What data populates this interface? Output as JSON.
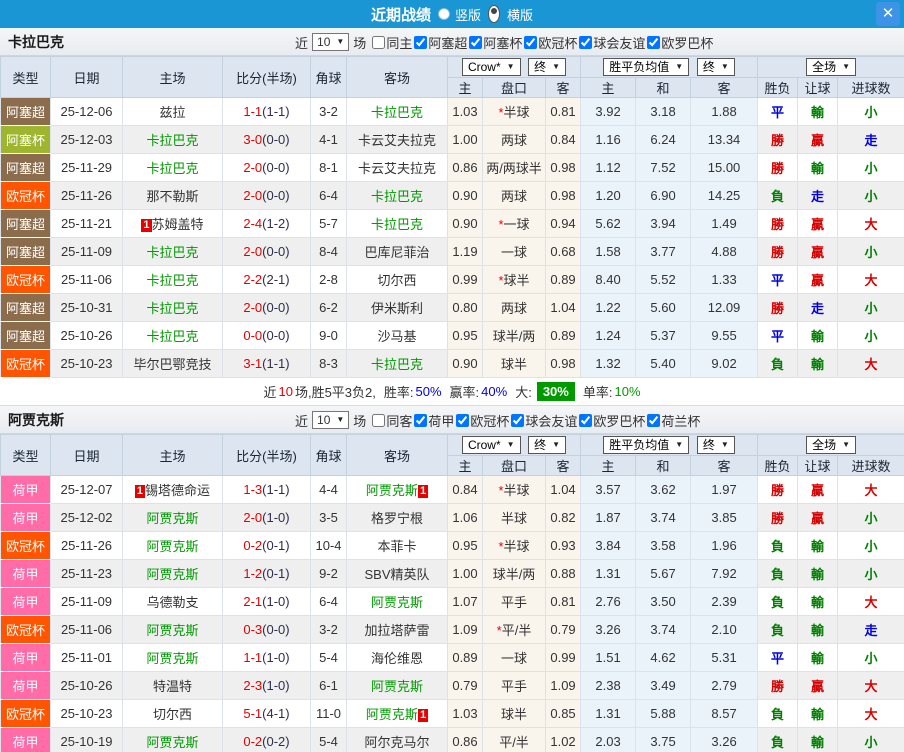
{
  "titlebar": {
    "title": "近期战绩",
    "vertical_label": "竖版",
    "horizontal_label": "横版"
  },
  "icons": {
    "close": "✕",
    "dropdown": "▼"
  },
  "hdr": {
    "type": "类型",
    "date": "日期",
    "home": "主场",
    "score": "比分(半场)",
    "corner": "角球",
    "away": "客场",
    "crow": "Crow*",
    "end": "终",
    "avg": "胜平负均值",
    "full": "全场",
    "sub_home": "主",
    "sub_pk": "盘口",
    "sub_away": "客",
    "sub_home2": "主",
    "sub_draw": "和",
    "sub_away2": "客",
    "sub_wl": "胜负",
    "sub_hcp": "让球",
    "sub_goals": "进球数"
  },
  "colors": {
    "阿塞超": "#8B6D4E",
    "阿塞杯": "#9DB52F",
    "欧冠杯": "#FF5400",
    "荷甲": "#FF6CA8",
    "荷兰杯": "#FF6CA8"
  },
  "sections": [
    {
      "team": "卡拉巴克",
      "filter": {
        "near": "近",
        "count": "10",
        "games": "场",
        "same": "同主",
        "same_checked": false,
        "leagues": [
          "阿塞超",
          "阿塞杯",
          "欧冠杯",
          "球会友谊",
          "欧罗巴杯"
        ]
      },
      "rows": [
        {
          "league": "阿塞超",
          "date": "25-12-06",
          "home_badge": "",
          "home": "兹拉",
          "home_green": false,
          "score": "1-1",
          "half": "(1-1)",
          "corner": "3-2",
          "away": "卡拉巴克",
          "away_badge": "",
          "away_green": true,
          "o_home": "1.03",
          "handicap": "*半球",
          "o_away": "0.81",
          "avg_home": "3.92",
          "avg_draw": "3.18",
          "avg_away": "1.88",
          "res": "平",
          "hres": "輸",
          "gres": "小"
        },
        {
          "league": "阿塞杯",
          "date": "25-12-03",
          "home_badge": "",
          "home": "卡拉巴克",
          "home_green": true,
          "score": "3-0",
          "half": "(0-0)",
          "corner": "4-1",
          "away": "卡云艾夫拉克",
          "away_badge": "",
          "away_green": false,
          "o_home": "1.00",
          "handicap": "两球",
          "o_away": "0.84",
          "avg_home": "1.16",
          "avg_draw": "6.24",
          "avg_away": "13.34",
          "res": "勝",
          "hres": "贏",
          "gres": "走"
        },
        {
          "league": "阿塞超",
          "date": "25-11-29",
          "home_badge": "",
          "home": "卡拉巴克",
          "home_green": true,
          "score": "2-0",
          "half": "(0-0)",
          "corner": "8-1",
          "away": "卡云艾夫拉克",
          "away_badge": "",
          "away_green": false,
          "o_home": "0.86",
          "handicap": "两/两球半",
          "o_away": "0.98",
          "avg_home": "1.12",
          "avg_draw": "7.52",
          "avg_away": "15.00",
          "res": "勝",
          "hres": "輸",
          "gres": "小"
        },
        {
          "league": "欧冠杯",
          "date": "25-11-26",
          "home_badge": "",
          "home": "那不勒斯",
          "home_green": false,
          "score": "2-0",
          "half": "(0-0)",
          "corner": "6-4",
          "away": "卡拉巴克",
          "away_badge": "",
          "away_green": true,
          "o_home": "0.90",
          "handicap": "两球",
          "o_away": "0.98",
          "avg_home": "1.20",
          "avg_draw": "6.90",
          "avg_away": "14.25",
          "res": "負",
          "hres": "走",
          "gres": "小"
        },
        {
          "league": "阿塞超",
          "date": "25-11-21",
          "home_badge": "1",
          "home": "苏姆盖特",
          "home_green": false,
          "score": "2-4",
          "half": "(1-2)",
          "corner": "5-7",
          "away": "卡拉巴克",
          "away_badge": "",
          "away_green": true,
          "o_home": "0.90",
          "handicap": "*一球",
          "o_away": "0.94",
          "avg_home": "5.62",
          "avg_draw": "3.94",
          "avg_away": "1.49",
          "res": "勝",
          "hres": "贏",
          "gres": "大"
        },
        {
          "league": "阿塞超",
          "date": "25-11-09",
          "home_badge": "",
          "home": "卡拉巴克",
          "home_green": true,
          "score": "2-0",
          "half": "(0-0)",
          "corner": "8-4",
          "away": "巴库尼菲治",
          "away_badge": "",
          "away_green": false,
          "o_home": "1.19",
          "handicap": "一球",
          "o_away": "0.68",
          "avg_home": "1.58",
          "avg_draw": "3.77",
          "avg_away": "4.88",
          "res": "勝",
          "hres": "贏",
          "gres": "小"
        },
        {
          "league": "欧冠杯",
          "date": "25-11-06",
          "home_badge": "",
          "home": "卡拉巴克",
          "home_green": true,
          "score": "2-2",
          "half": "(2-1)",
          "corner": "2-8",
          "away": "切尔西",
          "away_badge": "",
          "away_green": false,
          "o_home": "0.99",
          "handicap": "*球半",
          "o_away": "0.89",
          "avg_home": "8.40",
          "avg_draw": "5.52",
          "avg_away": "1.33",
          "res": "平",
          "hres": "贏",
          "gres": "大"
        },
        {
          "league": "阿塞超",
          "date": "25-10-31",
          "home_badge": "",
          "home": "卡拉巴克",
          "home_green": true,
          "score": "2-0",
          "half": "(0-0)",
          "corner": "6-2",
          "away": "伊米斯利",
          "away_badge": "",
          "away_green": false,
          "o_home": "0.80",
          "handicap": "两球",
          "o_away": "1.04",
          "avg_home": "1.22",
          "avg_draw": "5.60",
          "avg_away": "12.09",
          "res": "勝",
          "hres": "走",
          "gres": "小"
        },
        {
          "league": "阿塞超",
          "date": "25-10-26",
          "home_badge": "",
          "home": "卡拉巴克",
          "home_green": true,
          "score": "0-0",
          "half": "(0-0)",
          "corner": "9-0",
          "away": "沙马基",
          "away_badge": "",
          "away_green": false,
          "o_home": "0.95",
          "handicap": "球半/两",
          "o_away": "0.89",
          "avg_home": "1.24",
          "avg_draw": "5.37",
          "avg_away": "9.55",
          "res": "平",
          "hres": "輸",
          "gres": "小"
        },
        {
          "league": "欧冠杯",
          "date": "25-10-23",
          "home_badge": "",
          "home": "毕尔巴鄂竞技",
          "home_green": false,
          "score": "3-1",
          "half": "(1-1)",
          "corner": "8-3",
          "away": "卡拉巴克",
          "away_badge": "",
          "away_green": true,
          "o_home": "0.90",
          "handicap": "球半",
          "o_away": "0.98",
          "avg_home": "1.32",
          "avg_draw": "5.40",
          "avg_away": "9.02",
          "res": "負",
          "hres": "輸",
          "gres": "大"
        }
      ],
      "summary": {
        "near": "近",
        "count": "10",
        "record": "场,胜5平3负2,",
        "win_label": "胜率:",
        "win": "50%",
        "profit_label": "赢率:",
        "profit": "40%",
        "big_label": "大:",
        "big": "30%",
        "single_label": "单率:",
        "single": "10%"
      }
    },
    {
      "team": "阿贾克斯",
      "filter": {
        "near": "近",
        "count": "10",
        "games": "场",
        "same": "同客",
        "same_checked": false,
        "leagues": [
          "荷甲",
          "欧冠杯",
          "球会友谊",
          "欧罗巴杯",
          "荷兰杯"
        ]
      },
      "rows": [
        {
          "league": "荷甲",
          "date": "25-12-07",
          "home_badge": "1",
          "home": "锡塔德命运",
          "home_green": false,
          "score": "1-3",
          "half": "(1-1)",
          "corner": "4-4",
          "away": "阿贾克斯",
          "away_badge": "1",
          "away_green": true,
          "o_home": "0.84",
          "handicap": "*半球",
          "o_away": "1.04",
          "avg_home": "3.57",
          "avg_draw": "3.62",
          "avg_away": "1.97",
          "res": "勝",
          "hres": "贏",
          "gres": "大"
        },
        {
          "league": "荷甲",
          "date": "25-12-02",
          "home_badge": "",
          "home": "阿贾克斯",
          "home_green": true,
          "score": "2-0",
          "half": "(1-0)",
          "corner": "3-5",
          "away": "格罗宁根",
          "away_badge": "",
          "away_green": false,
          "o_home": "1.06",
          "handicap": "半球",
          "o_away": "0.82",
          "avg_home": "1.87",
          "avg_draw": "3.74",
          "avg_away": "3.85",
          "res": "勝",
          "hres": "贏",
          "gres": "小"
        },
        {
          "league": "欧冠杯",
          "date": "25-11-26",
          "home_badge": "",
          "home": "阿贾克斯",
          "home_green": true,
          "score": "0-2",
          "half": "(0-1)",
          "corner": "10-4",
          "away": "本菲卡",
          "away_badge": "",
          "away_green": false,
          "o_home": "0.95",
          "handicap": "*半球",
          "o_away": "0.93",
          "avg_home": "3.84",
          "avg_draw": "3.58",
          "avg_away": "1.96",
          "res": "負",
          "hres": "輸",
          "gres": "小"
        },
        {
          "league": "荷甲",
          "date": "25-11-23",
          "home_badge": "",
          "home": "阿贾克斯",
          "home_green": true,
          "score": "1-2",
          "half": "(0-1)",
          "corner": "9-2",
          "away": "SBV精英队",
          "away_badge": "",
          "away_green": false,
          "o_home": "1.00",
          "handicap": "球半/两",
          "o_away": "0.88",
          "avg_home": "1.31",
          "avg_draw": "5.67",
          "avg_away": "7.92",
          "res": "負",
          "hres": "輸",
          "gres": "小"
        },
        {
          "league": "荷甲",
          "date": "25-11-09",
          "home_badge": "",
          "home": "乌德勒支",
          "home_green": false,
          "score": "2-1",
          "half": "(1-0)",
          "corner": "6-4",
          "away": "阿贾克斯",
          "away_badge": "",
          "away_green": true,
          "o_home": "1.07",
          "handicap": "平手",
          "o_away": "0.81",
          "avg_home": "2.76",
          "avg_draw": "3.50",
          "avg_away": "2.39",
          "res": "負",
          "hres": "輸",
          "gres": "大"
        },
        {
          "league": "欧冠杯",
          "date": "25-11-06",
          "home_badge": "",
          "home": "阿贾克斯",
          "home_green": true,
          "score": "0-3",
          "half": "(0-0)",
          "corner": "3-2",
          "away": "加拉塔萨雷",
          "away_badge": "",
          "away_green": false,
          "o_home": "1.09",
          "handicap": "*平/半",
          "o_away": "0.79",
          "avg_home": "3.26",
          "avg_draw": "3.74",
          "avg_away": "2.10",
          "res": "負",
          "hres": "輸",
          "gres": "走"
        },
        {
          "league": "荷甲",
          "date": "25-11-01",
          "home_badge": "",
          "home": "阿贾克斯",
          "home_green": true,
          "score": "1-1",
          "half": "(1-0)",
          "corner": "5-4",
          "away": "海伦维恩",
          "away_badge": "",
          "away_green": false,
          "o_home": "0.89",
          "handicap": "一球",
          "o_away": "0.99",
          "avg_home": "1.51",
          "avg_draw": "4.62",
          "avg_away": "5.31",
          "res": "平",
          "hres": "輸",
          "gres": "小"
        },
        {
          "league": "荷甲",
          "date": "25-10-26",
          "home_badge": "",
          "home": "特温特",
          "home_green": false,
          "score": "2-3",
          "half": "(1-0)",
          "corner": "6-1",
          "away": "阿贾克斯",
          "away_badge": "",
          "away_green": true,
          "o_home": "0.79",
          "handicap": "平手",
          "o_away": "1.09",
          "avg_home": "2.38",
          "avg_draw": "3.49",
          "avg_away": "2.79",
          "res": "勝",
          "hres": "贏",
          "gres": "大"
        },
        {
          "league": "欧冠杯",
          "date": "25-10-23",
          "home_badge": "",
          "home": "切尔西",
          "home_green": false,
          "score": "5-1",
          "half": "(4-1)",
          "corner": "11-0",
          "away": "阿贾克斯",
          "away_badge": "1",
          "away_green": true,
          "o_home": "1.03",
          "handicap": "球半",
          "o_away": "0.85",
          "avg_home": "1.31",
          "avg_draw": "5.88",
          "avg_away": "8.57",
          "res": "負",
          "hres": "輸",
          "gres": "大"
        },
        {
          "league": "荷甲",
          "date": "25-10-19",
          "home_badge": "",
          "home": "阿贾克斯",
          "home_green": true,
          "score": "0-2",
          "half": "(0-2)",
          "corner": "5-4",
          "away": "阿尔克马尔",
          "away_badge": "",
          "away_green": false,
          "o_home": "0.86",
          "handicap": "平/半",
          "o_away": "1.02",
          "avg_home": "2.03",
          "avg_draw": "3.75",
          "avg_away": "3.26",
          "res": "負",
          "hres": "輸",
          "gres": "小"
        }
      ]
    }
  ]
}
